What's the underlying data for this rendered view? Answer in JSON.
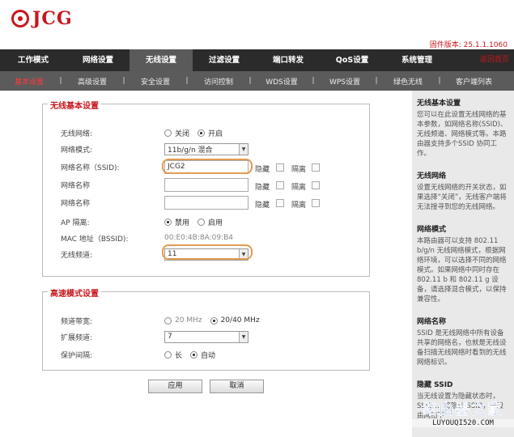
{
  "brand": {
    "name": "JCG"
  },
  "firmware": "固件版本: 25.1.1.1060",
  "nav": {
    "items": [
      "工作模式",
      "网络设置",
      "无线设置",
      "过滤设置",
      "端口转发",
      "QoS设置",
      "系统管理"
    ],
    "active_index": 2,
    "help_link": "返回首页"
  },
  "subnav": {
    "items": [
      "基本设置",
      "高级设置",
      "安全设置",
      "访问控制",
      "WDS设置",
      "WPS设置",
      "绿色无线",
      "客户端列表"
    ],
    "active_index": 0
  },
  "basic": {
    "legend": "无线基本设置",
    "wireless_label": "无线网络:",
    "wireless_off": "关闭",
    "wireless_on": "开启",
    "wireless_value": "开启",
    "mode_label": "网络模式:",
    "mode_value": "11b/g/n 混合",
    "ssid_label": "网络名称（SSID):",
    "ssid_value": "JCG2",
    "ssid2_label": "网络名称",
    "ssid3_label": "网络名称",
    "ssid4_label": "网络名称",
    "hide_label": "隐藏",
    "isolate_label": "隔离",
    "ap_label": "AP 隔离:",
    "ap_disable": "禁用",
    "ap_enable": "启用",
    "ap_value": "禁用",
    "mac_label": "MAC 地址（BSSID):",
    "mac_value": "00:E0:4B:8A:09:B4",
    "channel_label": "无线频道:",
    "channel_value": "11"
  },
  "ht": {
    "legend": "高速模式设置",
    "bw_label": "频道带宽:",
    "bw_20": "20 MHz",
    "bw_2040": "20/40 MHz",
    "bw_value": "20/40 MHz",
    "ext_label": "扩展频道:",
    "ext_value": "7",
    "gi_label": "保护间隔:",
    "gi_long": "长",
    "gi_auto": "自动",
    "gi_value": "自动"
  },
  "buttons": {
    "apply": "应用",
    "cancel": "取消"
  },
  "help": [
    {
      "title": "无线基本设置",
      "text": "您可以在此设置无线网络的基本参数，如网络名称(SSID)、无线频道、网络模式等。本路由器支持多个SSID 协同工作。"
    },
    {
      "title": "无线网络",
      "text": "设置无线网络的开关状态，如果选择“关闭”，无线客户端将无法搜寻到您的无线网络。"
    },
    {
      "title": "网络模式",
      "text": "本路由器可以支持 802.11 b/g/n 无线网络模式，根据网络环境，可以选择不同的网络模式。如果网络中同时存在 802.11 b 和 802.11 g 设备，请选择混合模式，以保持兼容性。"
    },
    {
      "title": "网络名称",
      "text": "SSID 是无线网络中所有设备共享的网络名，也就是无线设备扫描无线网络时看到的无线网络标识。"
    },
    {
      "title": "隐藏 SSID",
      "text": "当无线设置为隐藏状态时，SSID ... 将隐藏 SSID，一般由网络下"
    }
  ],
  "watermark": {
    "title": "路由器之家",
    "url": "LUYOUQI520.COM"
  },
  "colors": {
    "accent": "#c8161d",
    "nav_bg": "#2b2b2b",
    "subnav_bg": "#5b5b5b",
    "highlight": "#e39a52"
  }
}
